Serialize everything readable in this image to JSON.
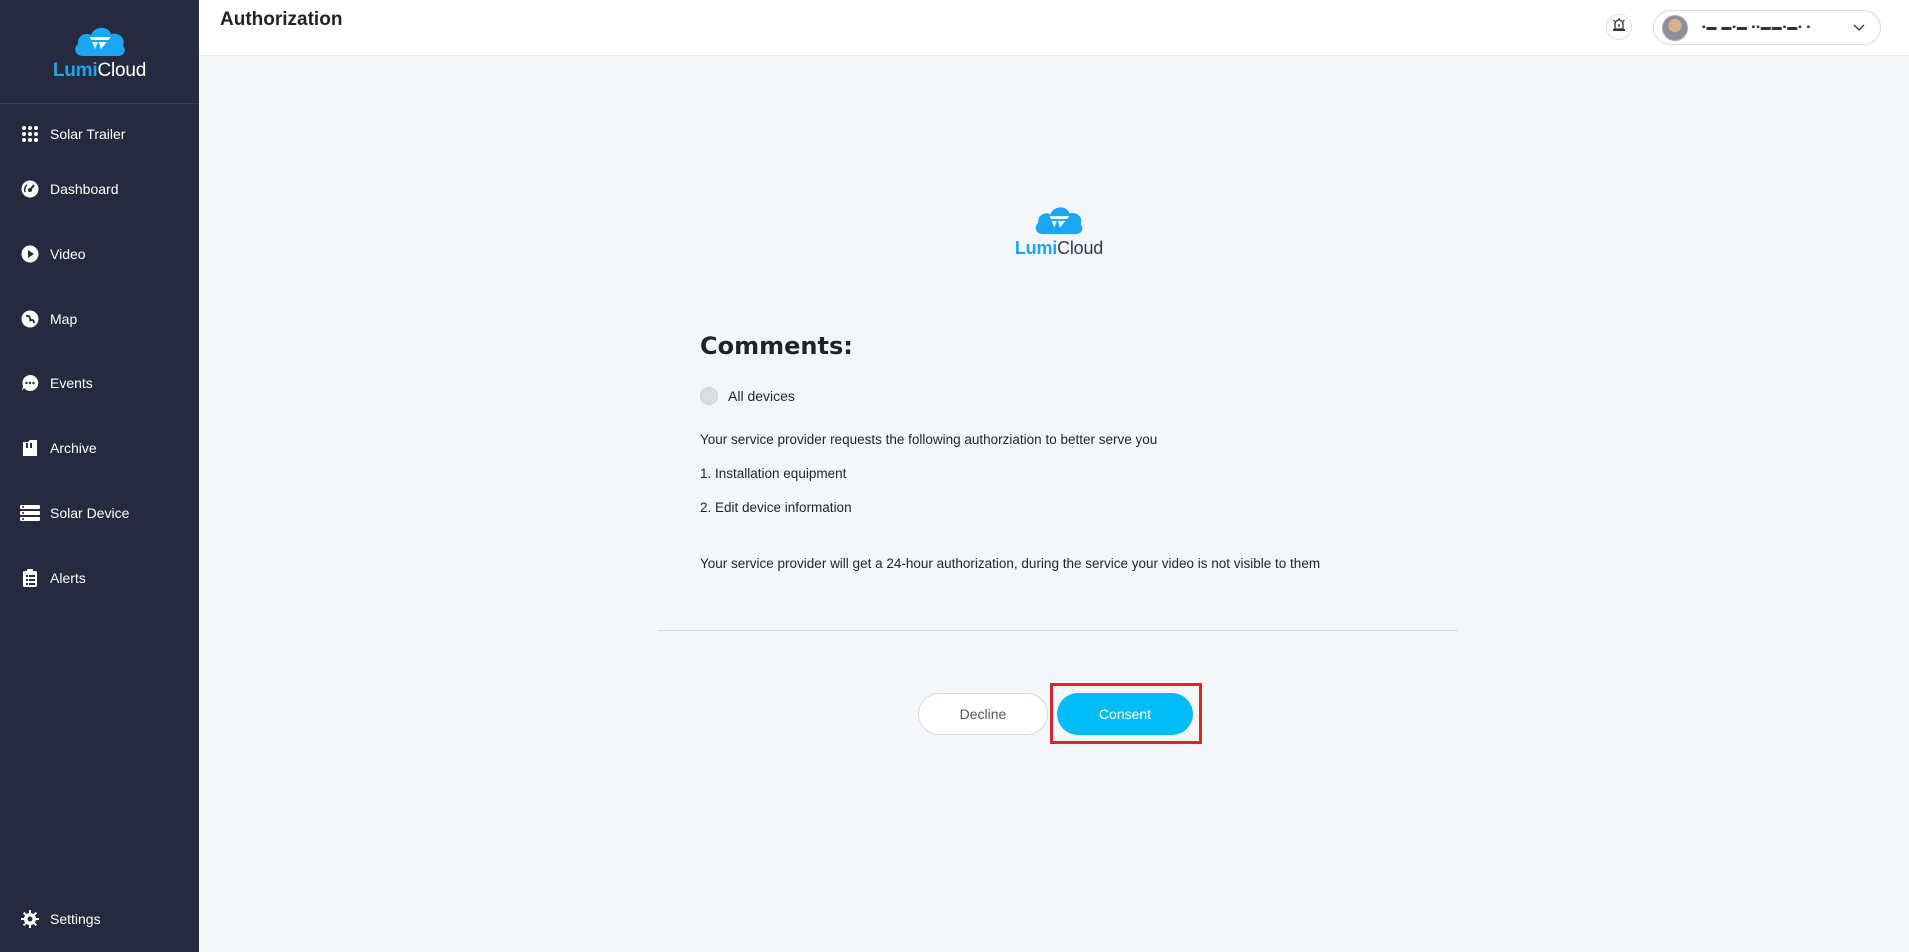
{
  "brand": {
    "lumi": "Lumi",
    "cloud": "Cloud"
  },
  "sidebar": {
    "items": [
      {
        "label": "Solar Trailer",
        "icon": "grid-icon"
      },
      {
        "label": "Dashboard",
        "icon": "gauge-icon"
      },
      {
        "label": "Video",
        "icon": "play-icon"
      },
      {
        "label": "Map",
        "icon": "map-leaf-icon"
      },
      {
        "label": "Events",
        "icon": "chat-bubble-icon"
      },
      {
        "label": "Archive",
        "icon": "folder-icon"
      },
      {
        "label": "Solar Device",
        "icon": "server-icon"
      },
      {
        "label": "Alerts",
        "icon": "clipboard-list-icon"
      }
    ],
    "settings": {
      "label": "Settings",
      "icon": "gear-icon"
    }
  },
  "header": {
    "title": "Authorization",
    "alarm_icon": "alarm-icon",
    "user": {
      "name": "▪▬ ▬▪▬ ▪▪▬▬▪▬▪ ▪",
      "chevron": "chevron-down-icon"
    }
  },
  "main": {
    "comments_title": "Comments:",
    "radio_label": "All devices",
    "request_text": "Your service provider requests the following authorziation to better serve you",
    "item_1": "1. Installation equipment",
    "item_2": "2. Edit device information",
    "note": "Your service provider will get a 24-hour authorization, during the service your video is not visible to them",
    "decline_label": "Decline",
    "consent_label": "Consent"
  },
  "colors": {
    "sidebar_bg": "#262a3e",
    "accent": "#00bdf7",
    "brand_blue": "#1aa6f0",
    "highlight": "#e0232b"
  }
}
